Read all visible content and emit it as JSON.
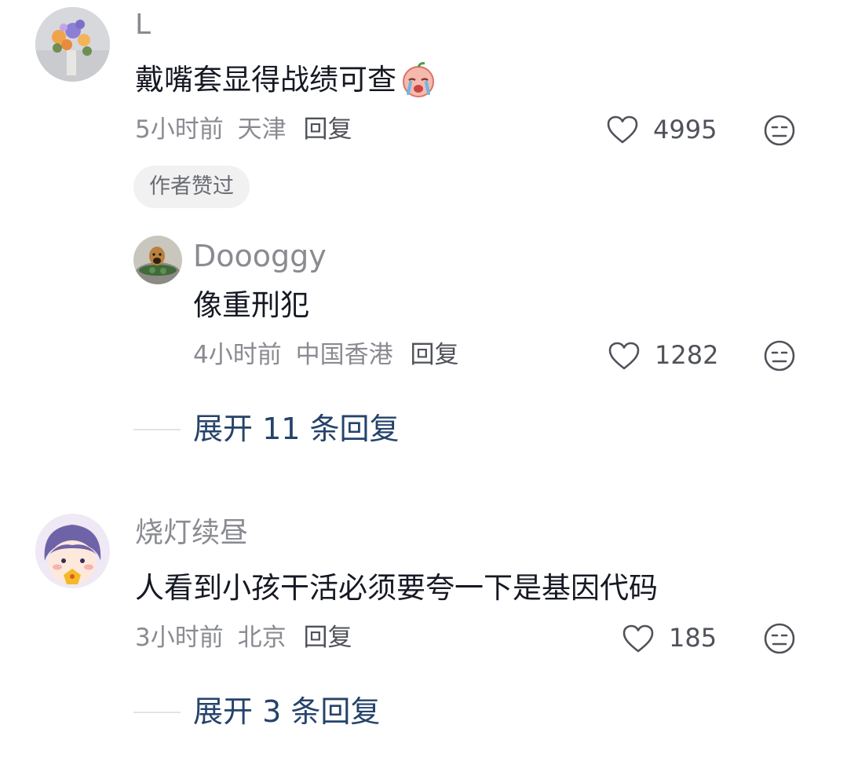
{
  "comments": [
    {
      "username": "L",
      "content": "戴嘴套显得战绩可查",
      "time": "5小时前",
      "location": "天津",
      "reply_label": "回复",
      "likes": "4995",
      "badge": "作者赞过",
      "avatar_icon": "flower-vase-avatar",
      "emoji_icon": "crying-emoji-icon",
      "replies": [
        {
          "username": "Doooggy",
          "content": "像重刑犯",
          "time": "4小时前",
          "location": "中国香港",
          "reply_label": "回复",
          "likes": "1282",
          "avatar_icon": "dog-in-tub-avatar"
        }
      ],
      "expand_label": "展开 11 条回复"
    },
    {
      "username": "烧灯续昼",
      "content": "人看到小孩干活必须要夸一下是基因代码",
      "time": "3小时前",
      "location": "北京",
      "reply_label": "回复",
      "likes": "185",
      "avatar_icon": "cartoon-boy-avatar",
      "expand_label": "展开 3 条回复"
    }
  ],
  "colors": {
    "text_primary": "#161823",
    "text_secondary": "#8a8b91",
    "link_blue": "#25436b",
    "badge_bg": "#f1f1f2"
  }
}
